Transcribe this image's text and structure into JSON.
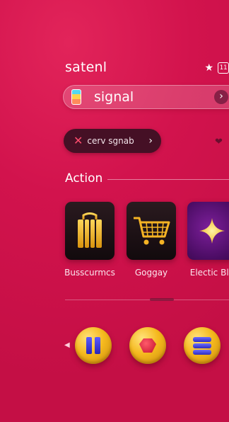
{
  "header": {
    "brand": "satenl",
    "status_star": "★",
    "status_box": "11"
  },
  "search": {
    "label": "signal",
    "arrow": "›",
    "icon": "app-icon"
  },
  "chip": {
    "label": "cerv sgnab",
    "chevron": "›"
  },
  "section": {
    "title": "Action"
  },
  "tiles": [
    {
      "label": "Busscurmcs",
      "icon": "tickets-icon"
    },
    {
      "label": "Goggay",
      "icon": "cart-icon"
    },
    {
      "label": "Electic Blu",
      "icon": "sparkle-icon"
    }
  ],
  "bottom_controls": [
    "pause-icon",
    "record-icon",
    "stack-icon"
  ],
  "colors": {
    "background": "#d2134d",
    "accent_gold": "#f5b91e",
    "chip_dark": "#451025"
  }
}
